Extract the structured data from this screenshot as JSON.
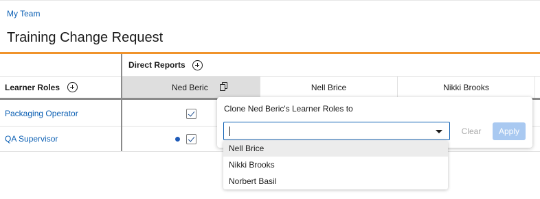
{
  "breadcrumb": "My Team",
  "page_title": "Training Change Request",
  "grid": {
    "direct_reports_label": "Direct Reports",
    "learner_roles_label": "Learner Roles",
    "columns": [
      "Ned Beric",
      "Nell Brice",
      "Nikki Brooks"
    ],
    "rows": [
      {
        "role": "Packaging Operator",
        "ned_checked": true,
        "changed": false
      },
      {
        "role": "QA Supervisor",
        "ned_checked": true,
        "changed": true
      }
    ]
  },
  "clone_popover": {
    "title": "Clone Ned Beric's Learner Roles to",
    "input_value": "",
    "clear_label": "Clear",
    "apply_label": "Apply",
    "options": [
      "Nell Brice",
      "Nikki Brooks",
      "Norbert Basil"
    ]
  },
  "colors": {
    "accent_orange": "#f0932b",
    "link_blue": "#0b5fb3",
    "apply_disabled": "#a9c9f1",
    "changed_dot": "#1e5bb8"
  }
}
